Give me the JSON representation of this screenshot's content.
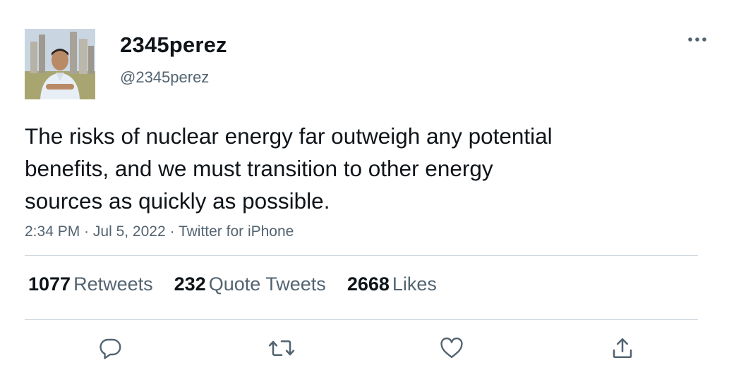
{
  "user": {
    "display_name": "2345perez",
    "handle": "@2345perez"
  },
  "tweet": {
    "text": "The risks of nuclear energy far outweigh any potential\nbenefits, and we must transition to other energy\nsources as quickly as possible.",
    "time": "2:34 PM",
    "date": "Jul 5, 2022",
    "source": "Twitter for iPhone",
    "separator": " · "
  },
  "stats": {
    "retweets_count": "1077",
    "retweets_label": "Retweets",
    "quotes_count": "232",
    "quotes_label": "Quote Tweets",
    "likes_count": "2668",
    "likes_label": "Likes"
  },
  "icons": {
    "more": "more-icon",
    "reply": "reply-icon",
    "retweet": "retweet-icon",
    "like": "heart-icon",
    "share": "share-icon"
  },
  "colors": {
    "text_primary": "#0f1419",
    "text_secondary": "#536471",
    "divider": "#cfd9de"
  }
}
